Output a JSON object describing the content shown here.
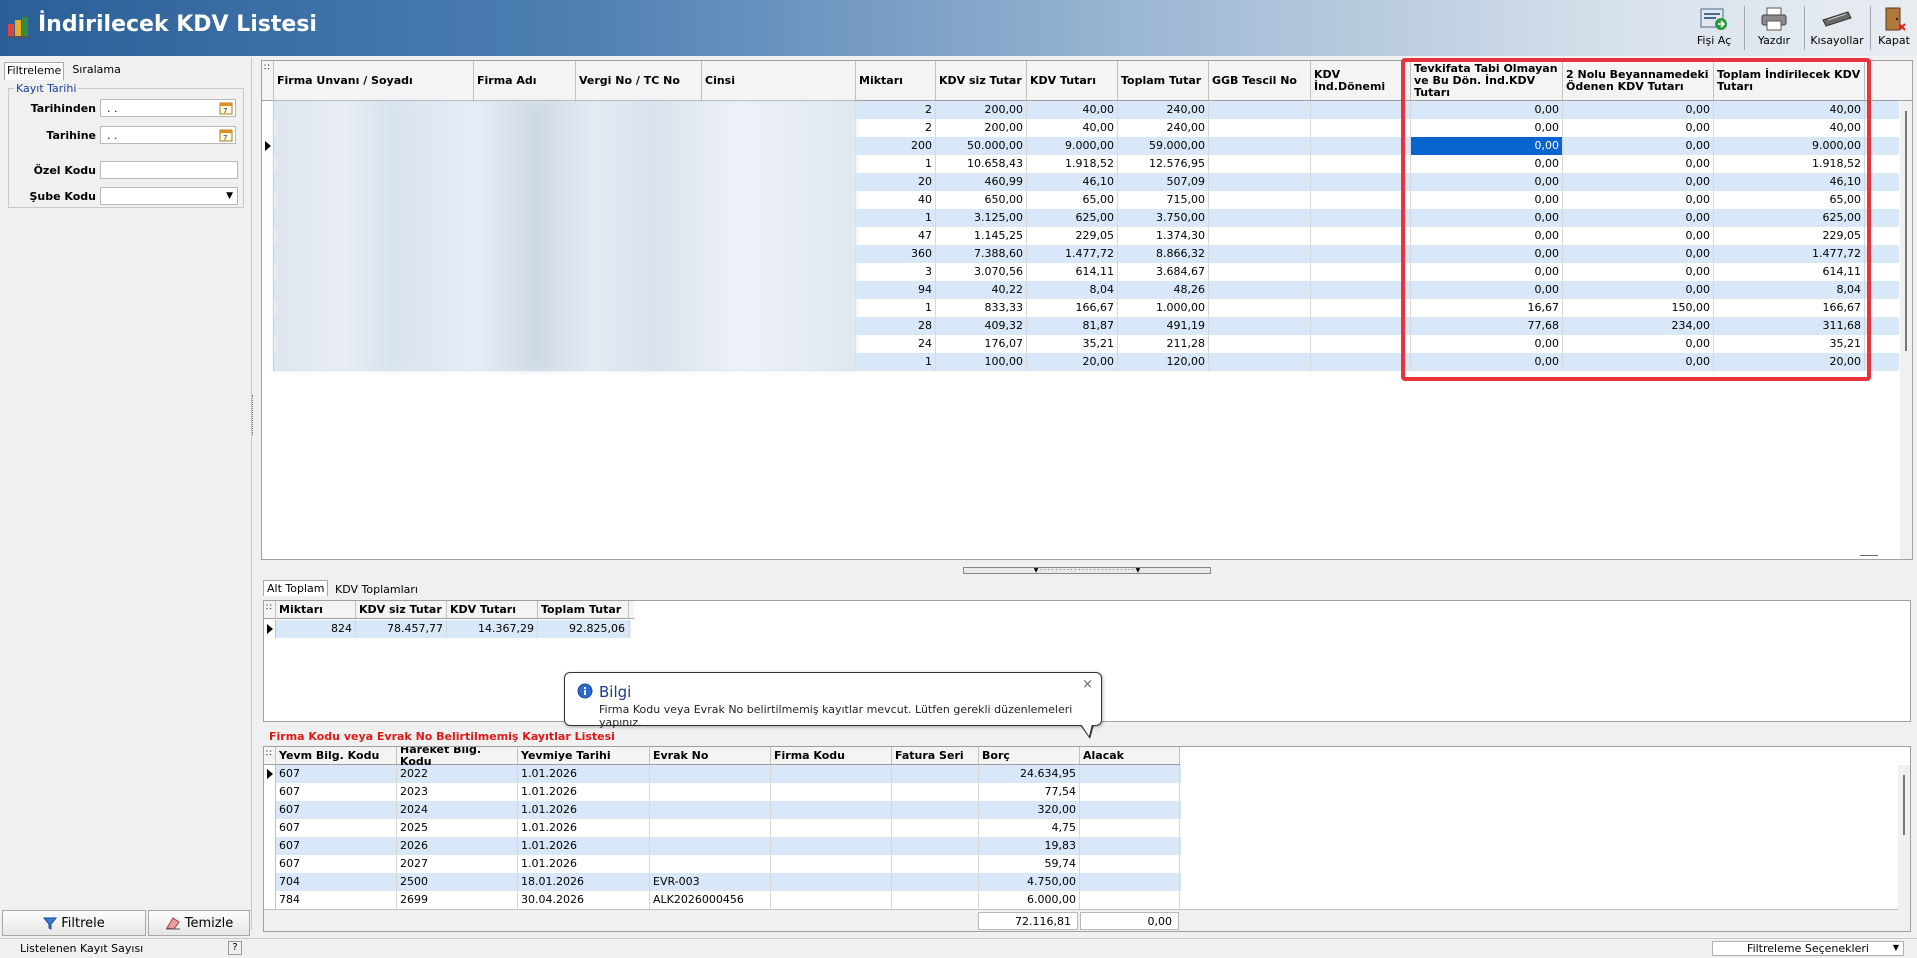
{
  "window": {
    "title": "İndirilecek KDV Listesi"
  },
  "toolbar": {
    "fisi_ac": "Fişi Aç",
    "yazdir": "Yazdır",
    "kisayollar": "Kısayollar",
    "kapat": "Kapat"
  },
  "left_panel": {
    "tabs": [
      "Filtreleme",
      "Sıralama"
    ],
    "fieldset_title": "Kayıt Tarihi",
    "tarihinden_label": "Tarihinden",
    "tarihinden_value": ". .",
    "tarihine_label": "Tarihine",
    "tarihine_value": ". .",
    "ozel_kodu_label": "Özel Kodu",
    "ozel_kodu_value": "",
    "sube_kodu_label": "Şube Kodu",
    "sube_kodu_value": "",
    "filtrele_button": "Filtrele",
    "temizle_button": "Temizle"
  },
  "main_grid": {
    "columns": [
      "Firma Unvanı / Soyadı",
      "Firma Adı",
      "Vergi No / TC No",
      "Cinsi",
      "Miktarı",
      "KDV siz Tutar",
      "KDV Tutarı",
      "Toplam Tutar",
      "GGB Tescil No",
      "KDV İnd.Dönemi",
      "Tevkifata Tabi Olmayan ve Bu Dön. İnd.KDV Tutarı",
      "2 Nolu Beyannamedeki Ödenen KDV Tutarı",
      "Toplam İndirilecek KDV Tutarı"
    ],
    "rows": [
      {
        "miktar": "2",
        "kdvsiz": "200,00",
        "kdv": "40,00",
        "toplam": "240,00",
        "tevk": "0,00",
        "beyan2": "0,00",
        "top_ind": "40,00"
      },
      {
        "miktar": "2",
        "kdvsiz": "200,00",
        "kdv": "40,00",
        "toplam": "240,00",
        "tevk": "0,00",
        "beyan2": "0,00",
        "top_ind": "40,00"
      },
      {
        "miktar": "200",
        "kdvsiz": "50.000,00",
        "kdv": "9.000,00",
        "toplam": "59.000,00",
        "tevk": "0,00",
        "beyan2": "0,00",
        "top_ind": "9.000,00"
      },
      {
        "miktar": "1",
        "kdvsiz": "10.658,43",
        "kdv": "1.918,52",
        "toplam": "12.576,95",
        "tevk": "0,00",
        "beyan2": "0,00",
        "top_ind": "1.918,52"
      },
      {
        "miktar": "20",
        "kdvsiz": "460,99",
        "kdv": "46,10",
        "toplam": "507,09",
        "tevk": "0,00",
        "beyan2": "0,00",
        "top_ind": "46,10"
      },
      {
        "miktar": "40",
        "kdvsiz": "650,00",
        "kdv": "65,00",
        "toplam": "715,00",
        "tevk": "0,00",
        "beyan2": "0,00",
        "top_ind": "65,00"
      },
      {
        "miktar": "1",
        "kdvsiz": "3.125,00",
        "kdv": "625,00",
        "toplam": "3.750,00",
        "tevk": "0,00",
        "beyan2": "0,00",
        "top_ind": "625,00"
      },
      {
        "miktar": "47",
        "kdvsiz": "1.145,25",
        "kdv": "229,05",
        "toplam": "1.374,30",
        "tevk": "0,00",
        "beyan2": "0,00",
        "top_ind": "229,05"
      },
      {
        "miktar": "360",
        "kdvsiz": "7.388,60",
        "kdv": "1.477,72",
        "toplam": "8.866,32",
        "tevk": "0,00",
        "beyan2": "0,00",
        "top_ind": "1.477,72"
      },
      {
        "miktar": "3",
        "kdvsiz": "3.070,56",
        "kdv": "614,11",
        "toplam": "3.684,67",
        "tevk": "0,00",
        "beyan2": "0,00",
        "top_ind": "614,11"
      },
      {
        "miktar": "94",
        "kdvsiz": "40,22",
        "kdv": "8,04",
        "toplam": "48,26",
        "tevk": "0,00",
        "beyan2": "0,00",
        "top_ind": "8,04"
      },
      {
        "miktar": "1",
        "kdvsiz": "833,33",
        "kdv": "166,67",
        "toplam": "1.000,00",
        "tevk": "16,67",
        "beyan2": "150,00",
        "top_ind": "166,67"
      },
      {
        "miktar": "28",
        "kdvsiz": "409,32",
        "kdv": "81,87",
        "toplam": "491,19",
        "tevk": "77,68",
        "beyan2": "234,00",
        "top_ind": "311,68"
      },
      {
        "miktar": "24",
        "kdvsiz": "176,07",
        "kdv": "35,21",
        "toplam": "211,28",
        "tevk": "0,00",
        "beyan2": "0,00",
        "top_ind": "35,21"
      },
      {
        "miktar": "1",
        "kdvsiz": "100,00",
        "kdv": "20,00",
        "toplam": "120,00",
        "tevk": "0,00",
        "beyan2": "0,00",
        "top_ind": "20,00"
      }
    ]
  },
  "summary": {
    "tabs": [
      "Alt Toplam",
      "KDV Toplamları"
    ],
    "columns": [
      "Miktarı",
      "KDV siz Tutar",
      "KDV Tutarı",
      "Toplam Tutar"
    ],
    "values": [
      "824",
      "78.457,77",
      "14.367,29",
      "92.825,06"
    ]
  },
  "tooltip": {
    "title": "Bilgi",
    "message": "Firma Kodu veya Evrak No belirtilmemiş kayıtlar mevcut. Lütfen gerekli düzenlemeleri yapınız.",
    "close": "×"
  },
  "missing_list": {
    "caption": "Firma Kodu veya Evrak No Belirtilmemiş Kayıtlar Listesi",
    "columns": [
      "Yevm Bilg. Kodu",
      "Hareket Bilg. Kodu",
      "Yevmiye Tarihi",
      "Evrak No",
      "Firma Kodu",
      "Fatura Seri",
      "Borç",
      "Alacak"
    ],
    "rows": [
      [
        "607",
        "2022",
        "1.01.2026",
        "",
        "",
        "",
        "24.634,95",
        ""
      ],
      [
        "607",
        "2023",
        "1.01.2026",
        "",
        "",
        "",
        "77,54",
        ""
      ],
      [
        "607",
        "2024",
        "1.01.2026",
        "",
        "",
        "",
        "320,00",
        ""
      ],
      [
        "607",
        "2025",
        "1.01.2026",
        "",
        "",
        "",
        "4,75",
        ""
      ],
      [
        "607",
        "2026",
        "1.01.2026",
        "",
        "",
        "",
        "19,83",
        ""
      ],
      [
        "607",
        "2027",
        "1.01.2026",
        "",
        "",
        "",
        "59,74",
        ""
      ],
      [
        "704",
        "2500",
        "18.01.2026",
        "EVR-003",
        "",
        "",
        "4.750,00",
        ""
      ],
      [
        "784",
        "2699",
        "30.04.2026",
        "ALK2026000456",
        "",
        "",
        "6.000,00",
        ""
      ]
    ],
    "total_borc": "72.116,81",
    "total_alacak": "0,00"
  },
  "status": {
    "left": "Listelenen Kayıt Sayısı",
    "help": "?",
    "right": "Filtreleme Seçenekleri"
  },
  "colors": {
    "highlight_frame": "#e8323c",
    "selected_cell": "#0a64d0",
    "alt_row": "#d8e8f8",
    "caption_red": "#e01818"
  }
}
